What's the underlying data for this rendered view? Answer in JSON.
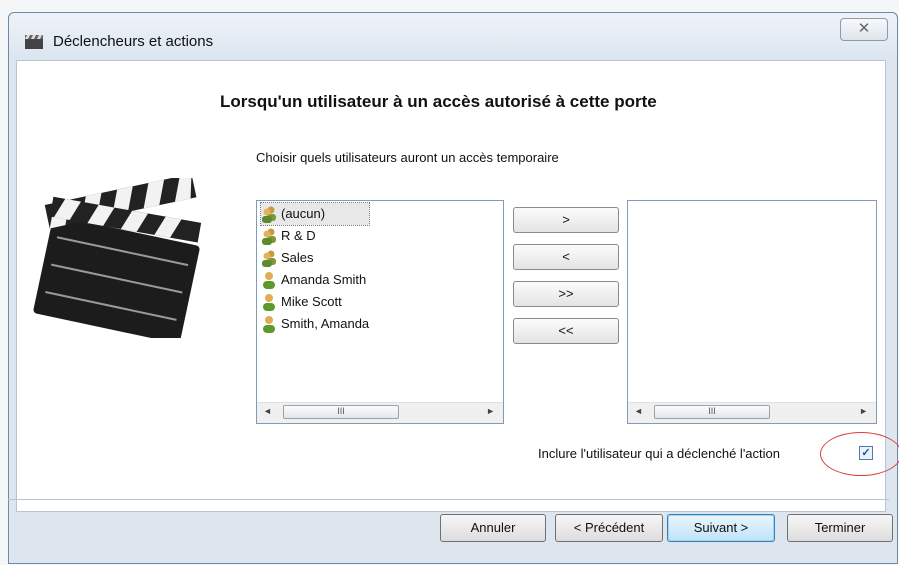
{
  "window": {
    "title": "Déclencheurs et actions",
    "close_label": "✕"
  },
  "heading": "Lorsqu'un utilisateur à un accès autorisé à cette porte",
  "subtext": "Choisir quels utilisateurs auront un accès temporaire",
  "left_list": {
    "items": [
      {
        "label": "(aucun)",
        "icon": "group-icon",
        "selected": true
      },
      {
        "label": "R & D",
        "icon": "group-icon"
      },
      {
        "label": "Sales",
        "icon": "group-icon"
      },
      {
        "label": "Amanda Smith",
        "icon": "user-icon"
      },
      {
        "label": "Mike Scott",
        "icon": "user-icon"
      },
      {
        "label": "Smith, Amanda",
        "icon": "user-icon"
      }
    ]
  },
  "right_list": {
    "items": []
  },
  "scrollbar": {
    "left_arrow": "◄",
    "right_arrow": "►",
    "grip": "III"
  },
  "move_buttons": {
    "add": ">",
    "remove": "<",
    "add_all": ">>",
    "remove_all": "<<"
  },
  "include_user": {
    "label": "Inclure l'utilisateur qui a déclenché l'action",
    "checked": true,
    "check_glyph": "✓"
  },
  "nav": {
    "cancel": "Annuler",
    "previous": "< Précédent",
    "next": "Suivant >",
    "finish": "Terminer"
  },
  "colors": {
    "annotation_circle": "#d94040",
    "primary_button": "#3c7fb1"
  }
}
